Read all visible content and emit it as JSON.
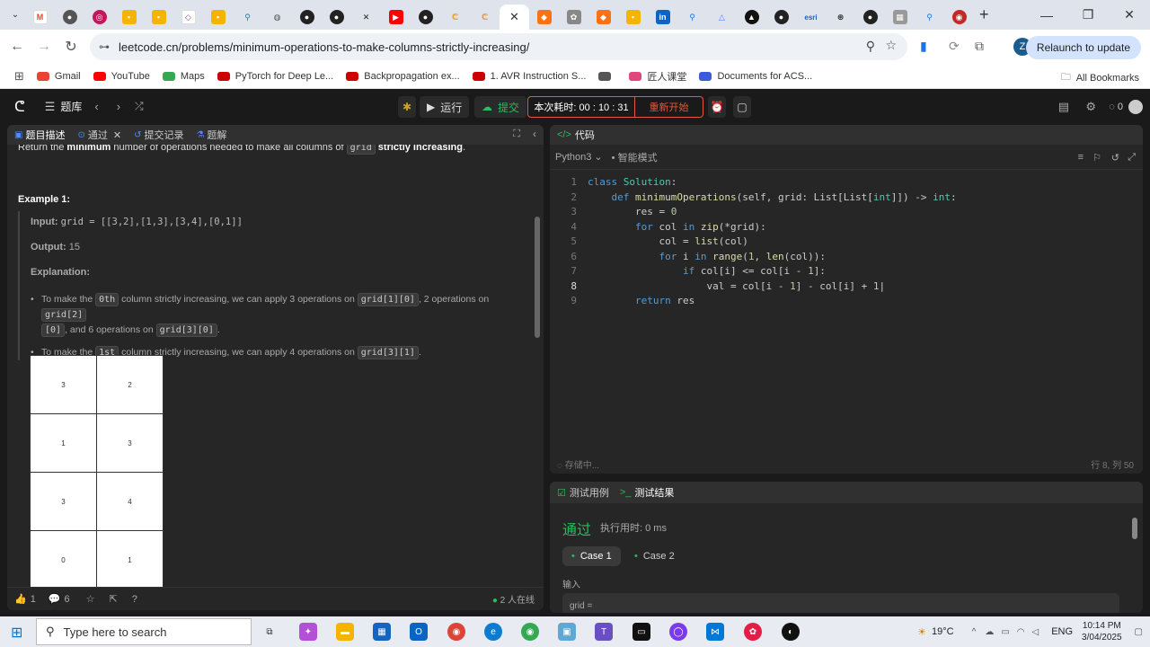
{
  "browser": {
    "url": "leetcode.cn/problems/minimum-operations-to-make-columns-strictly-increasing/",
    "relaunch_label": "Relaunch to update",
    "avatar_letter": "Z",
    "bookmarks": [
      {
        "label": "Gmail",
        "color": "#ea4335"
      },
      {
        "label": "YouTube",
        "color": "#ff0000"
      },
      {
        "label": "Maps",
        "color": "#34a853"
      },
      {
        "label": "PyTorch for Deep Le...",
        "color": "#cc0000"
      },
      {
        "label": "Backpropagation ex...",
        "color": "#cc0000"
      },
      {
        "label": "1. AVR Instruction S...",
        "color": "#cc0000"
      },
      {
        "label": "",
        "color": "#555555"
      },
      {
        "label": "匠人课堂",
        "color": "#e0457b"
      },
      {
        "label": "Documents for ACS...",
        "color": "#3b5bdb"
      }
    ],
    "all_bookmarks": "All Bookmarks"
  },
  "leetcode": {
    "nav_title": "题库",
    "run_label": "运行",
    "submit_label": "提交",
    "timer": "本次耗时: 00 : 10 : 31",
    "restart_label": "重新开始",
    "left_tabs": [
      "题目描述",
      "通过",
      "提交记录",
      "题解"
    ],
    "statement_pre": "Return the ",
    "statement_bold1": "minimum",
    "statement_mid": " number of operations needed to make all columns of ",
    "statement_code": "grid",
    "statement_bold2": " strictly increasing",
    "statement_end": ".",
    "example_title": "Example 1:",
    "input_label": "Input:",
    "input_value": "grid = [[3,2],[1,3],[3,4],[0,1]]",
    "output_label": "Output:",
    "output_value": "15",
    "explanation_label": "Explanation:",
    "bullet1": {
      "t1": "To make the ",
      "c1": "0th",
      "t2": " column strictly increasing, we can apply 3 operations on ",
      "c2": "grid[1][0]",
      "t3": ", 2 operations on ",
      "c3": "grid[2]",
      "c3b": "[0]",
      "t4": ", and 6 operations on ",
      "c4": "grid[3][0]",
      "t5": "."
    },
    "bullet2": {
      "t1": "To make the ",
      "c1": "1st",
      "t2": " column strictly increasing, we can apply 4 operations on ",
      "c2": "grid[3][1]",
      "t3": "."
    },
    "grid": [
      [
        "3",
        "2"
      ],
      [
        "1",
        "3"
      ],
      [
        "3",
        "4"
      ],
      [
        "0",
        "1"
      ]
    ],
    "footer": {
      "likes": "1",
      "comments": "6",
      "online": "2 人在线"
    },
    "code_header": "代码",
    "language": "Python3",
    "mode": "智能模式",
    "saving": "存储中...",
    "cursor_pos": "行 8, 列 50",
    "bottom_tabs": [
      "测试用例",
      "测试结果"
    ],
    "result": "通过",
    "runtime": "执行用时: 0 ms",
    "cases": [
      "Case 1",
      "Case 2"
    ],
    "input_heading": "输入",
    "input_partial": "grid ="
  },
  "taskbar": {
    "search_placeholder": "Type here to search",
    "weather": "19°C",
    "lang": "ENG",
    "time": "10:14 PM",
    "date": "3/04/2025"
  }
}
